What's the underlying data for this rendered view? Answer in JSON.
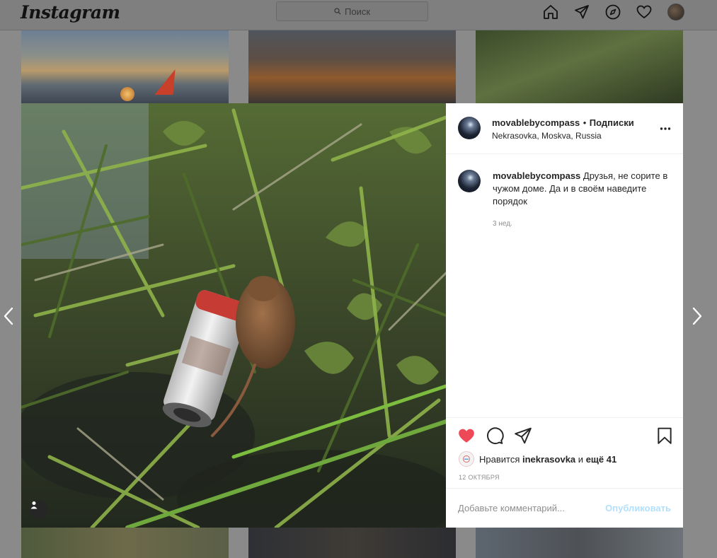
{
  "header": {
    "logo": "Instagram",
    "search_placeholder": "Поиск"
  },
  "post": {
    "username": "movablebycompass",
    "separator": "•",
    "follow_label": "Подписки",
    "location": "Nekrasovka, Moskva, Russia",
    "caption_username": "movablebycompass",
    "caption_text": "Друзья, не сорите в чужом доме. Да и в своём наведите порядок",
    "time_ago": "3 нед.",
    "likes_prefix": "Нравится",
    "likes_user": "inekrasovka",
    "likes_and": "и",
    "likes_others": "ещё 41",
    "date": "12 ОКТЯБРЯ",
    "comment_placeholder": "Добавьте комментарий...",
    "publish_label": "Опубликовать"
  },
  "icons": {
    "home": "home-icon",
    "direct": "paper-plane-icon",
    "explore": "compass-icon",
    "activity": "heart-icon",
    "like": "heart-filled-icon",
    "comment": "comment-icon",
    "share": "share-icon",
    "save": "bookmark-icon",
    "more": "more-horizontal-icon",
    "tag": "user-tag-icon",
    "prev": "chevron-left-icon",
    "next": "chevron-right-icon"
  },
  "colors": {
    "like": "#ed4956",
    "publish_disabled": "#b2dffc",
    "overlay": "#8a8a8a"
  }
}
